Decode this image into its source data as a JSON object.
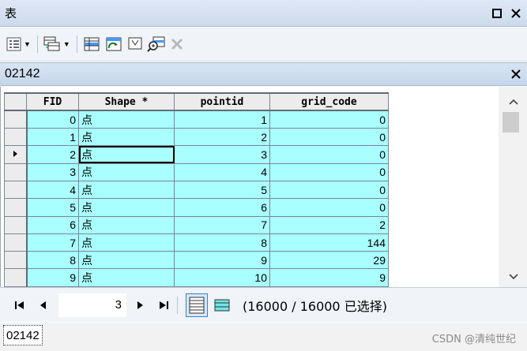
{
  "window": {
    "title": "表"
  },
  "toolbar": {
    "icons": [
      "table-options-icon",
      "related-tables-icon",
      "select-by-attributes-icon",
      "switch-selection-icon",
      "clear-selection-icon",
      "zoom-to-selected-icon",
      "delete-selected-icon"
    ]
  },
  "tab": {
    "title": "02142"
  },
  "table": {
    "columns": [
      "FID",
      "Shape *",
      "pointid",
      "grid_code"
    ],
    "rows": [
      {
        "fid": "0",
        "shape": "点",
        "pointid": "1",
        "grid_code": "0"
      },
      {
        "fid": "1",
        "shape": "点",
        "pointid": "2",
        "grid_code": "0"
      },
      {
        "fid": "2",
        "shape": "点",
        "pointid": "3",
        "grid_code": "0"
      },
      {
        "fid": "3",
        "shape": "点",
        "pointid": "4",
        "grid_code": "0"
      },
      {
        "fid": "4",
        "shape": "点",
        "pointid": "5",
        "grid_code": "0"
      },
      {
        "fid": "5",
        "shape": "点",
        "pointid": "6",
        "grid_code": "0"
      },
      {
        "fid": "6",
        "shape": "点",
        "pointid": "7",
        "grid_code": "2"
      },
      {
        "fid": "7",
        "shape": "点",
        "pointid": "8",
        "grid_code": "144"
      },
      {
        "fid": "8",
        "shape": "点",
        "pointid": "9",
        "grid_code": "29"
      },
      {
        "fid": "9",
        "shape": "点",
        "pointid": "10",
        "grid_code": "9"
      }
    ],
    "current_row_index": 2,
    "selection_color": "#a9fefe"
  },
  "navigation": {
    "current_record": "3",
    "selection_status": "(16000 / 16000 已选择)"
  },
  "bottom_tab": {
    "label": "02142"
  },
  "watermark": "CSDN @清纯世纪"
}
